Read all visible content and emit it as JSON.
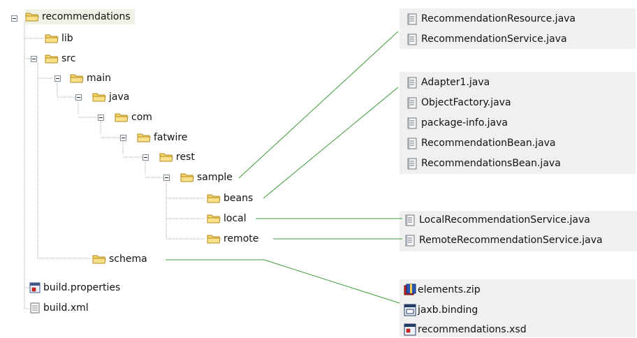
{
  "tree": {
    "root": "recommendations",
    "lib": "lib",
    "src": "src",
    "main": "main",
    "java": "java",
    "com": "com",
    "fatwire": "fatwire",
    "rest": "rest",
    "sample": "sample",
    "beans": "beans",
    "local": "local",
    "remote": "remote",
    "schema": "schema",
    "build_properties": "build.properties",
    "build_xml": "build.xml"
  },
  "panels": {
    "sample_files": [
      "RecommendationResource.java",
      "RecommendationService.java"
    ],
    "beans_files": [
      "Adapter1.java",
      "ObjectFactory.java",
      "package-info.java",
      "RecommendationBean.java",
      "RecommendationsBean.java"
    ],
    "local_files": [
      "LocalRecommendationService.java"
    ],
    "remote_files": [
      "RemoteRecommendationService.java"
    ],
    "schema_files": [
      "elements.zip",
      "jaxb.binding",
      "recommendations.xsd"
    ]
  },
  "colors": {
    "connector": "#3c9a3c",
    "folder_fill": "#f7d46b",
    "folder_edge": "#b08a1e",
    "panel": "#f0f0f0"
  },
  "icons": {
    "toggle": "collapse-icon",
    "folder": "folder-icon",
    "java_file": "java-file-icon",
    "zip_file": "zip-file-icon",
    "config_file": "config-file-icon",
    "xml_file": "xml-file-icon"
  }
}
